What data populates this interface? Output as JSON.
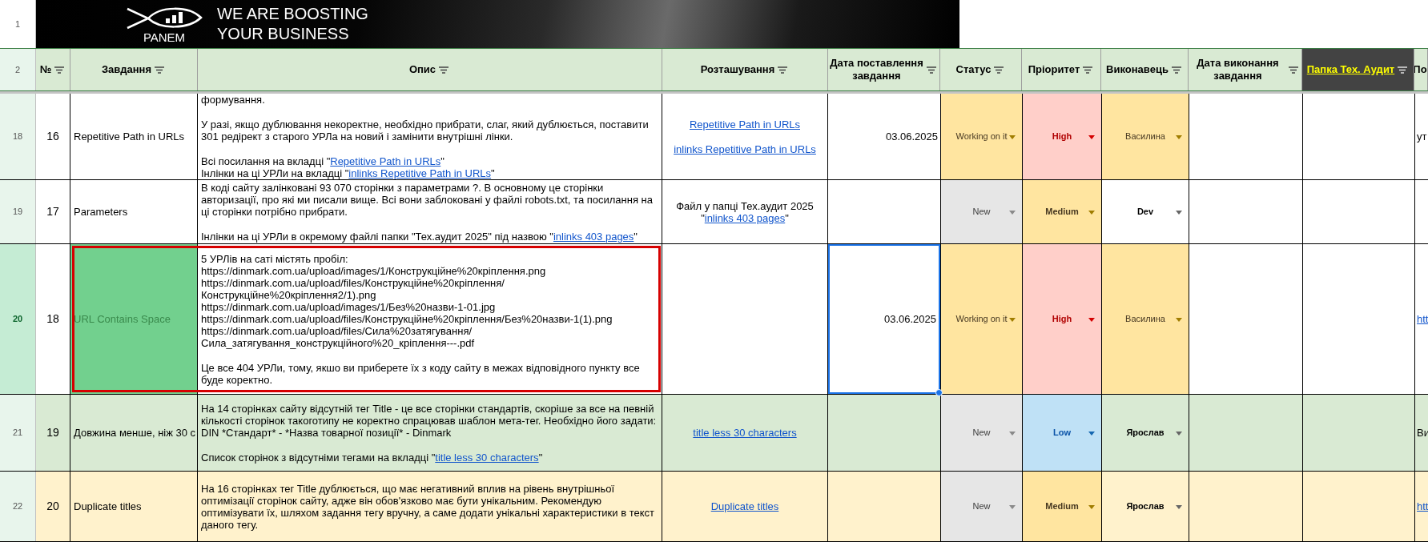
{
  "banner": {
    "logo_text": "PANEM",
    "slogan": [
      "WE ARE BOOSTING",
      "YOUR BUSINESS"
    ],
    "row_number": "1"
  },
  "header": {
    "row_number": "2",
    "columns": [
      {
        "text": "№",
        "kind": "plain",
        "filter": true
      },
      {
        "text": "Завдання",
        "kind": "plain",
        "filter": true
      },
      {
        "text": "Опис",
        "kind": "plain",
        "filter": true
      },
      {
        "text": "Розташування",
        "kind": "plain",
        "filter": true
      },
      {
        "text": "Дата поставлення завдання",
        "kind": "plain",
        "filter": true
      },
      {
        "text": "Статус",
        "kind": "plain",
        "filter": true
      },
      {
        "text": "Пріоритет",
        "kind": "plain",
        "filter": true
      },
      {
        "text": "Виконавець",
        "kind": "plain",
        "filter": true
      },
      {
        "text": "Дата виконання завдання",
        "kind": "plain",
        "filter": true
      },
      {
        "text": "Папка Тех. Аудит",
        "kind": "link",
        "filter": true
      },
      {
        "text": "По",
        "kind": "plain",
        "filter": false
      }
    ]
  },
  "rows": [
    {
      "row_number": "18",
      "selected": false,
      "color": "#ffffff",
      "number": "16",
      "task": "Repetitive Path in URLs",
      "task_highlight": false,
      "annotated": false,
      "description": [
        [
          [
            {
              "text": "формування.",
              "link": false
            }
          ]
        ],
        [
          [
            {
              "text": "У разі, якщо дублювання некоректне, необхідно прибрати, слаг, який дублюється, поставити 301 редірект з старого УРЛа на новий і замінити внутрішні лінки.",
              "link": false
            }
          ]
        ],
        [
          [
            {
              "text": "Всі посилання на вкладці \"",
              "link": false
            },
            {
              "text": "Repetitive Path in URLs",
              "link": true
            },
            {
              "text": "\"",
              "link": false
            }
          ],
          [
            {
              "text": "Інлінки на ці УРЛи на вкладці \"",
              "link": false
            },
            {
              "text": "inlinks Repetitive Path in URLs",
              "link": true
            },
            {
              "text": "\"",
              "link": false
            }
          ]
        ]
      ],
      "location": [
        [
          [
            {
              "text": "Repetitive Path in URLs",
              "link": true
            }
          ]
        ],
        [
          [
            {
              "text": "inlinks Repetitive Path in URLs",
              "link": true
            }
          ]
        ]
      ],
      "date": "03.06.2025",
      "date_selected": false,
      "status": {
        "text": "Working on it",
        "color": "#ffe5a0"
      },
      "priority": {
        "text": "High",
        "color": "#ffcfc9"
      },
      "assignee": {
        "text": "Василина",
        "color": "#ffe5a0"
      },
      "column_11": {
        "text": "ут",
        "link": false
      }
    },
    {
      "row_number": "19",
      "selected": false,
      "color": "#ffffff",
      "number": "17",
      "task": "Parameters",
      "task_highlight": false,
      "annotated": false,
      "description": [
        [
          [
            {
              "text": "В коді сайту залінковані 93 070 сторінки з параметрами ?. В основному це сторінки авторизації, про які ми писали вище. Всі вони заблоковані у файлі robots.txt, та посилання на ці сторінки потрібно прибрати.",
              "link": false
            }
          ]
        ],
        [
          [
            {
              "text": "Інлінки на ці УРЛи в окремому файлі папки \"Тех.аудит 2025\" під назвою \"",
              "link": false
            },
            {
              "text": "inlinks 403 pages",
              "link": true
            },
            {
              "text": "\"",
              "link": false
            }
          ]
        ]
      ],
      "location": [
        [
          [
            {
              "text": "Файл у папці Тех.аудит 2025",
              "link": false
            }
          ],
          [
            {
              "text": "\"",
              "link": false
            },
            {
              "text": "inlinks 403 pages",
              "link": true
            },
            {
              "text": "\"",
              "link": false
            }
          ]
        ]
      ],
      "status": {
        "text": "New",
        "color": "#e6e6e6"
      },
      "priority": {
        "text": "Medium",
        "color": "#ffe5a0"
      },
      "assignee": {
        "text": "Dev"
      },
      "date_selected": false
    },
    {
      "row_number": "20",
      "selected": true,
      "color": "#ffffff",
      "number": "18",
      "task": "URL Contains Space",
      "task_highlight": true,
      "annotated": true,
      "description": [
        [
          [
            {
              "text": "5 УРЛів на саті містять пробіл:",
              "link": false
            }
          ],
          [
            {
              "text": "https://dinmark.com.ua/upload/images/1/Конструкційне%20кріплення.png",
              "link": false
            }
          ],
          [
            {
              "text": "https://dinmark.com.ua/upload/files/Конструкційне%20кріплення/Конструкційне%20кріплення2/1).png",
              "link": false
            }
          ],
          [
            {
              "text": "https://dinmark.com.ua/upload/images/1/Без%20назви-1-01.jpg",
              "link": false
            }
          ],
          [
            {
              "text": "https://dinmark.com.ua/upload/files/Конструкційне%20кріплення/Без%20назви-1(1).png",
              "link": false
            }
          ],
          [
            {
              "text": "https://dinmark.com.ua/upload/files/Сила%20затягування/Сила_затягування_конструкційного%20_кріплення---.pdf",
              "link": false
            }
          ]
        ],
        [
          [
            {
              "text": "Це все 404 УРЛи, тому, якшо ви приберете їх з коду сайту в межах відповідного пункту все буде коректно.",
              "link": false
            }
          ]
        ]
      ],
      "date": "03.06.2025",
      "date_selected": true,
      "status": {
        "text": "Working on it",
        "color": "#ffe5a0"
      },
      "priority": {
        "text": "High",
        "color": "#ffcfc9"
      },
      "assignee": {
        "text": "Василина",
        "color": "#ffe5a0"
      },
      "column_11": {
        "text": "htt",
        "link": true
      }
    },
    {
      "row_number": "21",
      "selected": false,
      "color": "#d9ead3",
      "number": "19",
      "task": "Довжина менше, ніж 30 с",
      "task_highlight": false,
      "annotated": false,
      "description": [
        [
          [
            {
              "text": "На 14 сторінках сайту відсутній тег Title - це все сторінки стандартів, скоріше за все на певній кількості сторінок такоготипу не коректно спрацював шаблон мета-тег. Необхідно його задати:",
              "link": false
            }
          ],
          [
            {
              "text": "DIN *Стандарт* - *Назва товарної позиції* - Dinmark",
              "link": false
            }
          ]
        ],
        [
          [
            {
              "text": "Список сторінок з відсутніми тегами на вкладці \"",
              "link": false
            },
            {
              "text": "title less 30 characters",
              "link": true
            },
            {
              "text": "\"",
              "link": false
            }
          ]
        ]
      ],
      "location": [
        [
          [
            {
              "text": "title less 30 characters",
              "link": true
            }
          ]
        ]
      ],
      "date_selected": false,
      "status": {
        "text": "New",
        "color": "#e6e6e6"
      },
      "priority": {
        "text": "Low",
        "color": "#bfe1f6"
      },
      "assignee": {
        "text": "Ярослав"
      },
      "column_11": {
        "text": "Ви",
        "link": false
      }
    },
    {
      "row_number": "22",
      "selected": false,
      "color": "#fff2cc",
      "number": "20",
      "task": "Duplicate titles",
      "task_highlight": false,
      "annotated": false,
      "description": [
        [
          [
            {
              "text": "На 16 сторінках тег Title дублюється, що має негативний вплив на рівень внутрішньої оптимізації сторінок сайту, адже він обов'язково має бути унікальним. Рекомендую оптимізувати їх, шляхом задання тегу вручну, а саме додати унікальні характеристики в текст даного тегу.",
              "link": false
            }
          ]
        ]
      ],
      "location": [
        [
          [
            {
              "text": "Duplicate titles",
              "link": true
            }
          ]
        ]
      ],
      "date_selected": false,
      "status": {
        "text": "New",
        "color": "#e6e6e6"
      },
      "priority": {
        "text": "Medium",
        "color": "#ffe5a0"
      },
      "assignee": {
        "text": "Ярослав"
      },
      "column_11": {
        "text": "htt",
        "link": true
      }
    }
  ]
}
